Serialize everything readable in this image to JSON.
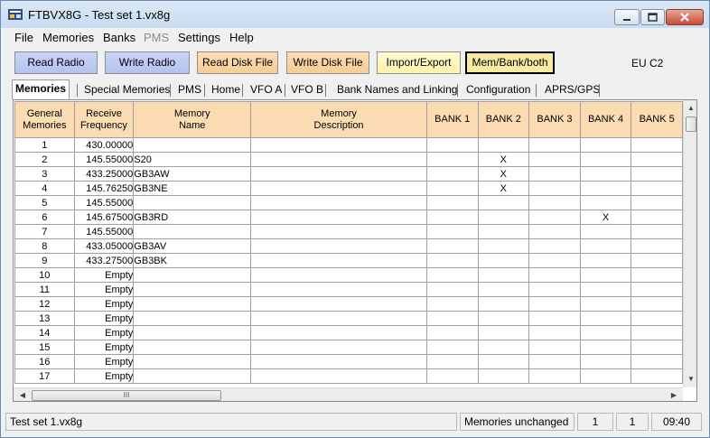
{
  "window": {
    "title": "FTBVX8G - Test set 1.vx8g"
  },
  "menu": [
    "File",
    "Memories",
    "Banks",
    "PMS",
    "Settings",
    "Help"
  ],
  "toolbar": {
    "read_radio": "Read Radio",
    "write_radio": "Write Radio",
    "read_disk": "Read Disk File",
    "write_disk": "Write Disk File",
    "import_export": "Import/Export",
    "mem_bank": "Mem/Bank/both",
    "region": "EU C2"
  },
  "tabs": [
    "Memories",
    "Special Memories",
    "PMS",
    "Home",
    "VFO A",
    "VFO B",
    "Bank Names and Linking",
    "Configuration",
    "APRS/GPS"
  ],
  "grid": {
    "headers": {
      "general": [
        "General",
        "Memories"
      ],
      "receive": [
        "Receive",
        "Frequency"
      ],
      "mem_name": [
        "Memory",
        "Name"
      ],
      "mem_desc": [
        "Memory",
        "Description"
      ],
      "bank1": "BANK 1",
      "bank2": "BANK 2",
      "bank3": "BANK 3",
      "bank4": "BANK 4",
      "bank5": "BANK 5"
    },
    "rows": [
      {
        "num": "1",
        "freq": "430.00000",
        "name": "",
        "desc": "",
        "b1": "",
        "b2": "",
        "b3": "",
        "b4": "",
        "b5": ""
      },
      {
        "num": "2",
        "freq": "145.55000",
        "name": "S20",
        "desc": "",
        "b1": "",
        "b2": "X",
        "b3": "",
        "b4": "",
        "b5": ""
      },
      {
        "num": "3",
        "freq": "433.25000",
        "name": "GB3AW",
        "desc": "",
        "b1": "",
        "b2": "X",
        "b3": "",
        "b4": "",
        "b5": ""
      },
      {
        "num": "4",
        "freq": "145.76250",
        "name": "GB3NE",
        "desc": "",
        "b1": "",
        "b2": "X",
        "b3": "",
        "b4": "",
        "b5": ""
      },
      {
        "num": "5",
        "freq": "145.55000",
        "name": "",
        "desc": "",
        "b1": "",
        "b2": "",
        "b3": "",
        "b4": "",
        "b5": ""
      },
      {
        "num": "6",
        "freq": "145.67500",
        "name": "GB3RD",
        "desc": "",
        "b1": "",
        "b2": "",
        "b3": "",
        "b4": "X",
        "b5": ""
      },
      {
        "num": "7",
        "freq": "145.55000",
        "name": "",
        "desc": "",
        "b1": "",
        "b2": "",
        "b3": "",
        "b4": "",
        "b5": ""
      },
      {
        "num": "8",
        "freq": "433.05000",
        "name": "GB3AV",
        "desc": "",
        "b1": "",
        "b2": "",
        "b3": "",
        "b4": "",
        "b5": ""
      },
      {
        "num": "9",
        "freq": "433.27500",
        "name": "GB3BK",
        "desc": "",
        "b1": "",
        "b2": "",
        "b3": "",
        "b4": "",
        "b5": ""
      },
      {
        "num": "10",
        "freq": "Empty",
        "name": "",
        "desc": "",
        "b1": "",
        "b2": "",
        "b3": "",
        "b4": "",
        "b5": ""
      },
      {
        "num": "11",
        "freq": "Empty",
        "name": "",
        "desc": "",
        "b1": "",
        "b2": "",
        "b3": "",
        "b4": "",
        "b5": ""
      },
      {
        "num": "12",
        "freq": "Empty",
        "name": "",
        "desc": "",
        "b1": "",
        "b2": "",
        "b3": "",
        "b4": "",
        "b5": ""
      },
      {
        "num": "13",
        "freq": "Empty",
        "name": "",
        "desc": "",
        "b1": "",
        "b2": "",
        "b3": "",
        "b4": "",
        "b5": ""
      },
      {
        "num": "14",
        "freq": "Empty",
        "name": "",
        "desc": "",
        "b1": "",
        "b2": "",
        "b3": "",
        "b4": "",
        "b5": ""
      },
      {
        "num": "15",
        "freq": "Empty",
        "name": "",
        "desc": "",
        "b1": "",
        "b2": "",
        "b3": "",
        "b4": "",
        "b5": ""
      },
      {
        "num": "16",
        "freq": "Empty",
        "name": "",
        "desc": "",
        "b1": "",
        "b2": "",
        "b3": "",
        "b4": "",
        "b5": ""
      },
      {
        "num": "17",
        "freq": "Empty",
        "name": "",
        "desc": "",
        "b1": "",
        "b2": "",
        "b3": "",
        "b4": "",
        "b5": ""
      }
    ]
  },
  "hscroll_grip": "III",
  "status": {
    "file": "Test set 1.vx8g",
    "state": "Memories unchanged",
    "val1": "1",
    "val2": "1",
    "time": "09:40"
  },
  "colors": {
    "header_bg": "#fbdcb3",
    "button_blue": "#b3c2f0",
    "button_orange": "#f6cd92",
    "button_yellow": "#fff2a8"
  }
}
